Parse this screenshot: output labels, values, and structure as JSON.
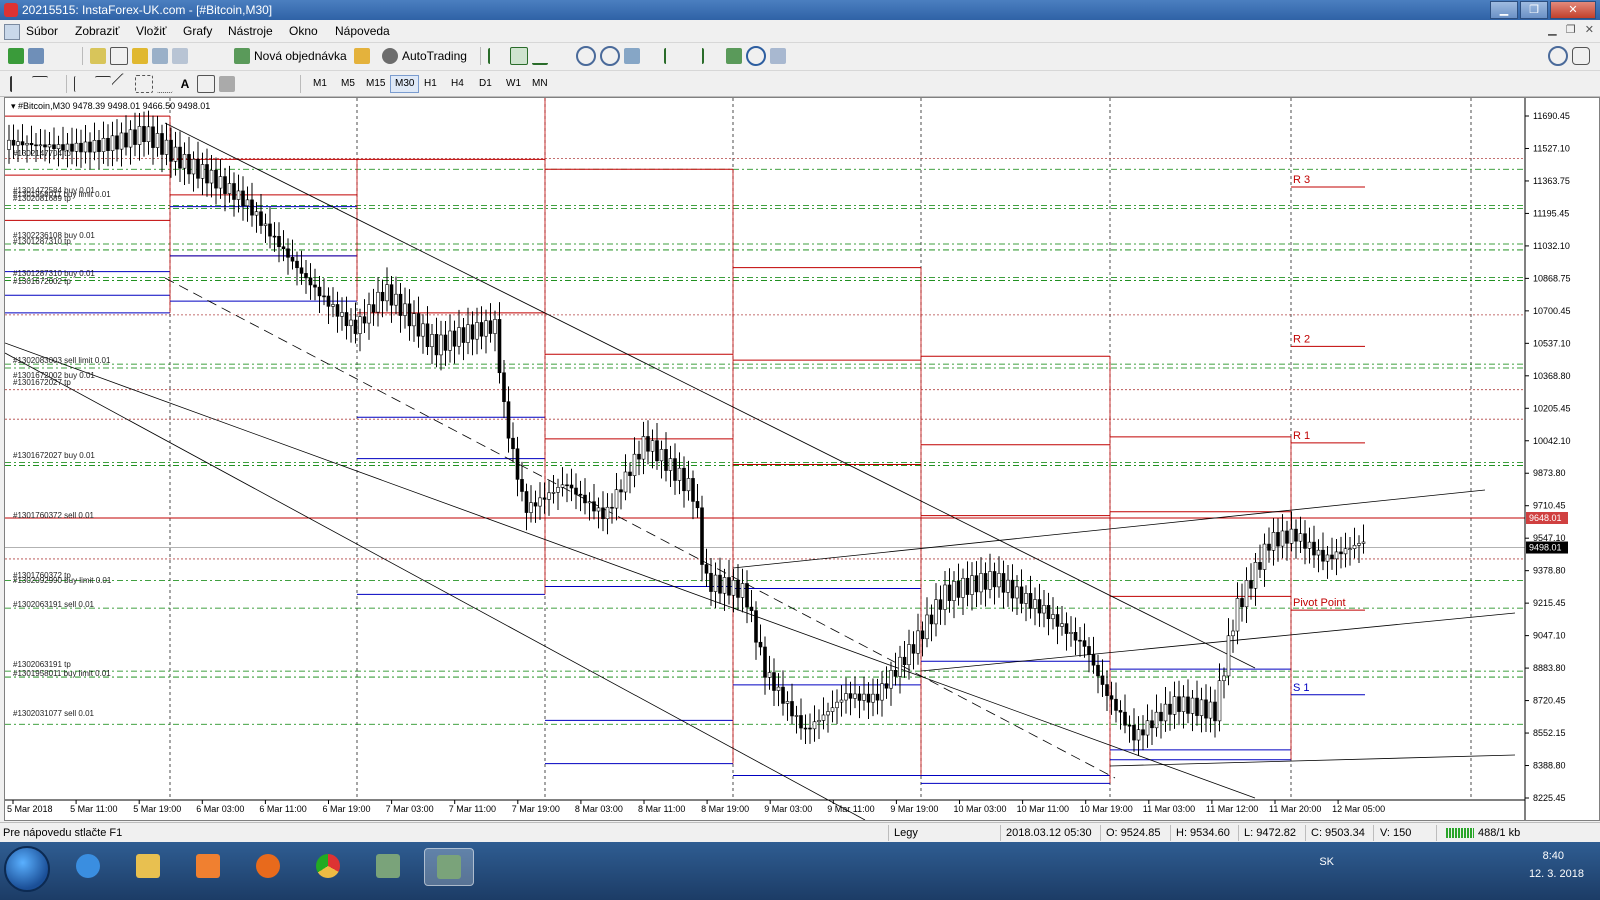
{
  "window": {
    "title": "20215515: InstaForex-UK.com - [#Bitcoin,M30]",
    "btn_minimize": "▁",
    "btn_maximize": "❐",
    "btn_close": "✕"
  },
  "menu": [
    "Súbor",
    "Zobraziť",
    "Vložiť",
    "Grafy",
    "Nástroje",
    "Okno",
    "Nápoveda"
  ],
  "toolbar": {
    "new_order": "Nová objednávka",
    "autotrading": "AutoTrading",
    "timeframes": [
      "M1",
      "M5",
      "M15",
      "M30",
      "H1",
      "H4",
      "D1",
      "W1",
      "MN"
    ],
    "active_timeframe": "M30"
  },
  "chart": {
    "symbol_header": "#Bitcoin,M30  9478.39 9498.01 9466.50 9498.01",
    "price_axis": [
      "11690.45",
      "11527.10",
      "11363.75",
      "11195.45",
      "11032.10",
      "10868.75",
      "10700.45",
      "10537.10",
      "10368.80",
      "10205.45",
      "10042.10",
      "9873.80",
      "9710.45",
      "9547.10",
      "9378.80",
      "9215.45",
      "9047.10",
      "8883.80",
      "8720.45",
      "8552.15",
      "8388.80",
      "8225.45"
    ],
    "price_min": 8225.45,
    "price_max": 11690.45,
    "time_axis": [
      "5 Mar 2018",
      "5 Mar 11:00",
      "5 Mar 19:00",
      "6 Mar 03:00",
      "6 Mar 11:00",
      "6 Mar 19:00",
      "7 Mar 03:00",
      "7 Mar 11:00",
      "7 Mar 19:00",
      "8 Mar 03:00",
      "8 Mar 11:00",
      "8 Mar 19:00",
      "9 Mar 03:00",
      "9 Mar 11:00",
      "9 Mar 19:00",
      "10 Mar 03:00",
      "10 Mar 11:00",
      "10 Mar 19:00",
      "11 Mar 03:00",
      "11 Mar 12:00",
      "11 Mar 20:00",
      "12 Mar 05:00"
    ],
    "current_price_label": "9498.01",
    "sell_order_price_label": "9648.01",
    "pivot_labels": [
      "R 3",
      "R 2",
      "R 1",
      "Pivot Point",
      "S 1"
    ],
    "order_labels": [
      "#1302147704 tp",
      "#1301472584 buy 0.01",
      "#1301958011 buy limit 0.01",
      "#1302081689 tp",
      "#1302236108 buy 0.01",
      "#1301287310 tp",
      "#1301287310 buy 0.01",
      "#1301672002 tp",
      "#1302083003 sell limit 0.01",
      "#1301672002 buy 0.01",
      "#1301672027 tp",
      "#1301672027 buy 0.01",
      "#1301760372 sell 0.01",
      "#1301760372 tp",
      "#1302092990 buy limit 0.01",
      "#1302063191 sell 0.01",
      "#1302063191 tp",
      "#1301958011 buy limit 0.01",
      "#1302031077 sell 0.01"
    ]
  },
  "status": {
    "help": "Pre nápovedu stlačte F1",
    "profile": "Legy",
    "datetime": "2018.03.12 05:30",
    "open": "O: 9524.85",
    "high": "H: 9534.60",
    "low": "L: 9472.82",
    "close": "C: 9503.34",
    "volume": "V: 150",
    "traffic": "488/1 kb"
  },
  "taskbar": {
    "lang": "SK",
    "time": "8:40",
    "date": "12. 3. 2018"
  },
  "colors": {
    "bull": "#000000",
    "red_levels": "#c00000",
    "blue_levels": "#0000c0",
    "green_dash": "#008000"
  }
}
